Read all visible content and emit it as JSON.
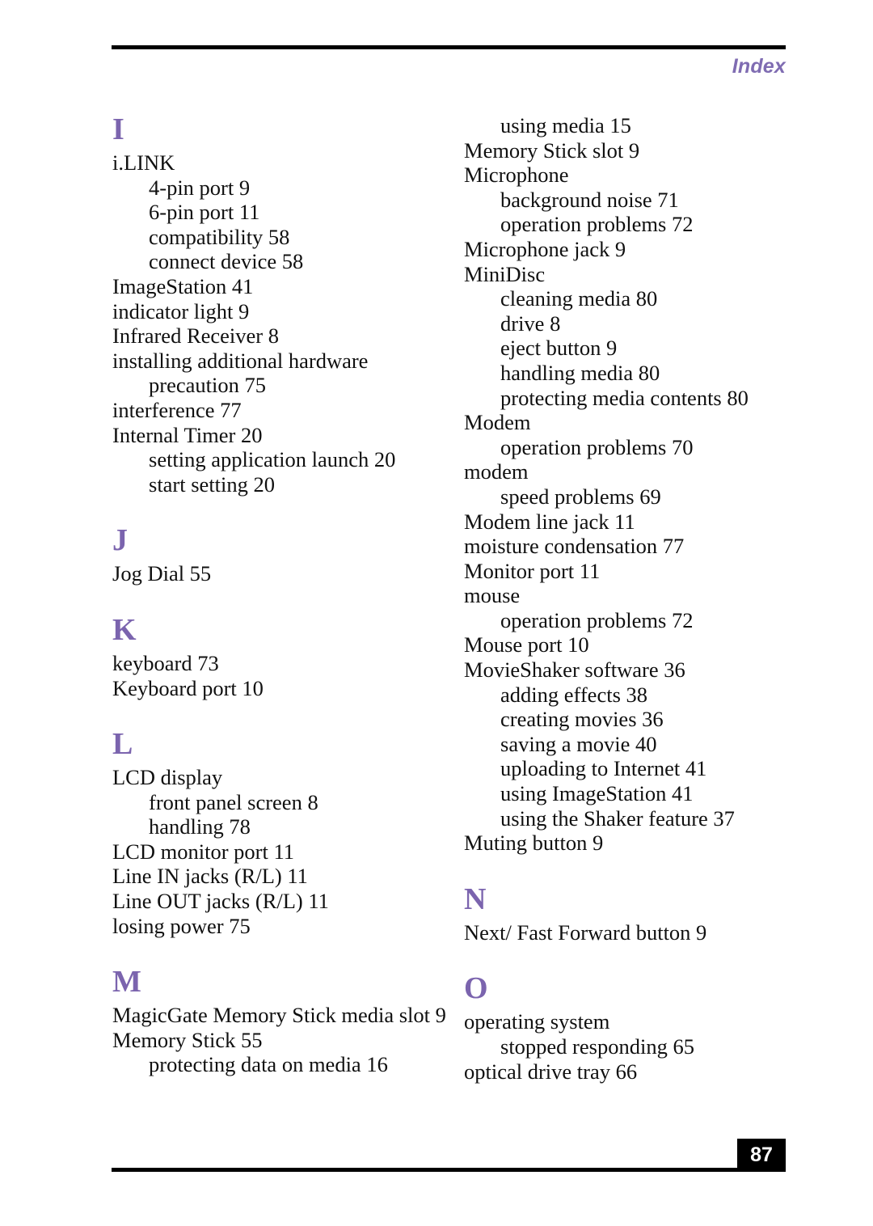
{
  "header": {
    "label": "Index",
    "accent_color": "#7f6cb2"
  },
  "footer": {
    "page_number": "87"
  },
  "theme": {
    "section_letter_color": "#7b64ae",
    "text_color": "#101010",
    "rule_color": "#000000",
    "page_box_color": "#000000",
    "page_number_color": "#ffffff"
  },
  "columns": {
    "left": [
      {
        "letter": "I",
        "entries": [
          {
            "text": "i.LINK",
            "level": 0
          },
          {
            "text": "4-pin port 9",
            "level": 1
          },
          {
            "text": "6-pin port 11",
            "level": 1
          },
          {
            "text": "compatibility 58",
            "level": 1
          },
          {
            "text": "connect device 58",
            "level": 1
          },
          {
            "text": "ImageStation 41",
            "level": 0
          },
          {
            "text": "indicator light 9",
            "level": 0
          },
          {
            "text": "Infrared Receiver 8",
            "level": 0
          },
          {
            "text": "installing additional hardware",
            "level": 0
          },
          {
            "text": "precaution 75",
            "level": 1
          },
          {
            "text": "interference 77",
            "level": 0
          },
          {
            "text": "Internal Timer 20",
            "level": 0
          },
          {
            "text": "setting application launch 20",
            "level": 1
          },
          {
            "text": "start setting 20",
            "level": 1
          }
        ]
      },
      {
        "letter": "J",
        "entries": [
          {
            "text": "Jog Dial 55",
            "level": 0
          }
        ]
      },
      {
        "letter": "K",
        "entries": [
          {
            "text": "keyboard 73",
            "level": 0
          },
          {
            "text": "Keyboard port 10",
            "level": 0
          }
        ]
      },
      {
        "letter": "L",
        "entries": [
          {
            "text": "LCD display",
            "level": 0
          },
          {
            "text": "front panel screen 8",
            "level": 1
          },
          {
            "text": "handling 78",
            "level": 1
          },
          {
            "text": "LCD monitor port 11",
            "level": 0
          },
          {
            "text": "Line IN jacks (R/L) 11",
            "level": 0
          },
          {
            "text": "Line OUT jacks (R/L) 11",
            "level": 0
          },
          {
            "text": "losing power 75",
            "level": 0
          }
        ]
      },
      {
        "letter": "M",
        "entries": [
          {
            "text": "MagicGate Memory Stick media slot 9",
            "level": 0
          },
          {
            "text": "Memory Stick 55",
            "level": 0
          },
          {
            "text": "protecting data on media 16",
            "level": 1
          }
        ]
      }
    ],
    "right": [
      {
        "letter": null,
        "continued": true,
        "entries": [
          {
            "text": "using media 15",
            "level": 1
          },
          {
            "text": "Memory Stick slot 9",
            "level": 0
          },
          {
            "text": "Microphone",
            "level": 0
          },
          {
            "text": "background noise 71",
            "level": 1
          },
          {
            "text": "operation problems 72",
            "level": 1
          },
          {
            "text": "Microphone jack 9",
            "level": 0
          },
          {
            "text": "MiniDisc",
            "level": 0
          },
          {
            "text": "cleaning media 80",
            "level": 1
          },
          {
            "text": "drive 8",
            "level": 1
          },
          {
            "text": "eject button 9",
            "level": 1
          },
          {
            "text": "handling media 80",
            "level": 1
          },
          {
            "text": "protecting media contents 80",
            "level": 1
          },
          {
            "text": "Modem",
            "level": 0
          },
          {
            "text": "operation problems 70",
            "level": 1
          },
          {
            "text": "modem",
            "level": 0
          },
          {
            "text": "speed problems 69",
            "level": 1
          },
          {
            "text": "Modem line jack 11",
            "level": 0
          },
          {
            "text": "moisture condensation 77",
            "level": 0
          },
          {
            "text": "Monitor port 11",
            "level": 0
          },
          {
            "text": "mouse",
            "level": 0
          },
          {
            "text": "operation problems 72",
            "level": 1
          },
          {
            "text": "Mouse port 10",
            "level": 0
          },
          {
            "text": "MovieShaker software 36",
            "level": 0
          },
          {
            "text": "adding effects 38",
            "level": 1
          },
          {
            "text": "creating movies 36",
            "level": 1
          },
          {
            "text": "saving a movie 40",
            "level": 1
          },
          {
            "text": "uploading to Internet 41",
            "level": 1
          },
          {
            "text": "using ImageStation 41",
            "level": 1
          },
          {
            "text": "using the Shaker feature 37",
            "level": 1
          },
          {
            "text": "Muting button 9",
            "level": 0
          }
        ]
      },
      {
        "letter": "N",
        "entries": [
          {
            "text": "Next/ Fast Forward button 9",
            "level": 0
          }
        ]
      },
      {
        "letter": "O",
        "entries": [
          {
            "text": "operating system",
            "level": 0
          },
          {
            "text": "stopped responding 65",
            "level": 1
          },
          {
            "text": "optical drive tray 66",
            "level": 0
          }
        ]
      }
    ]
  }
}
